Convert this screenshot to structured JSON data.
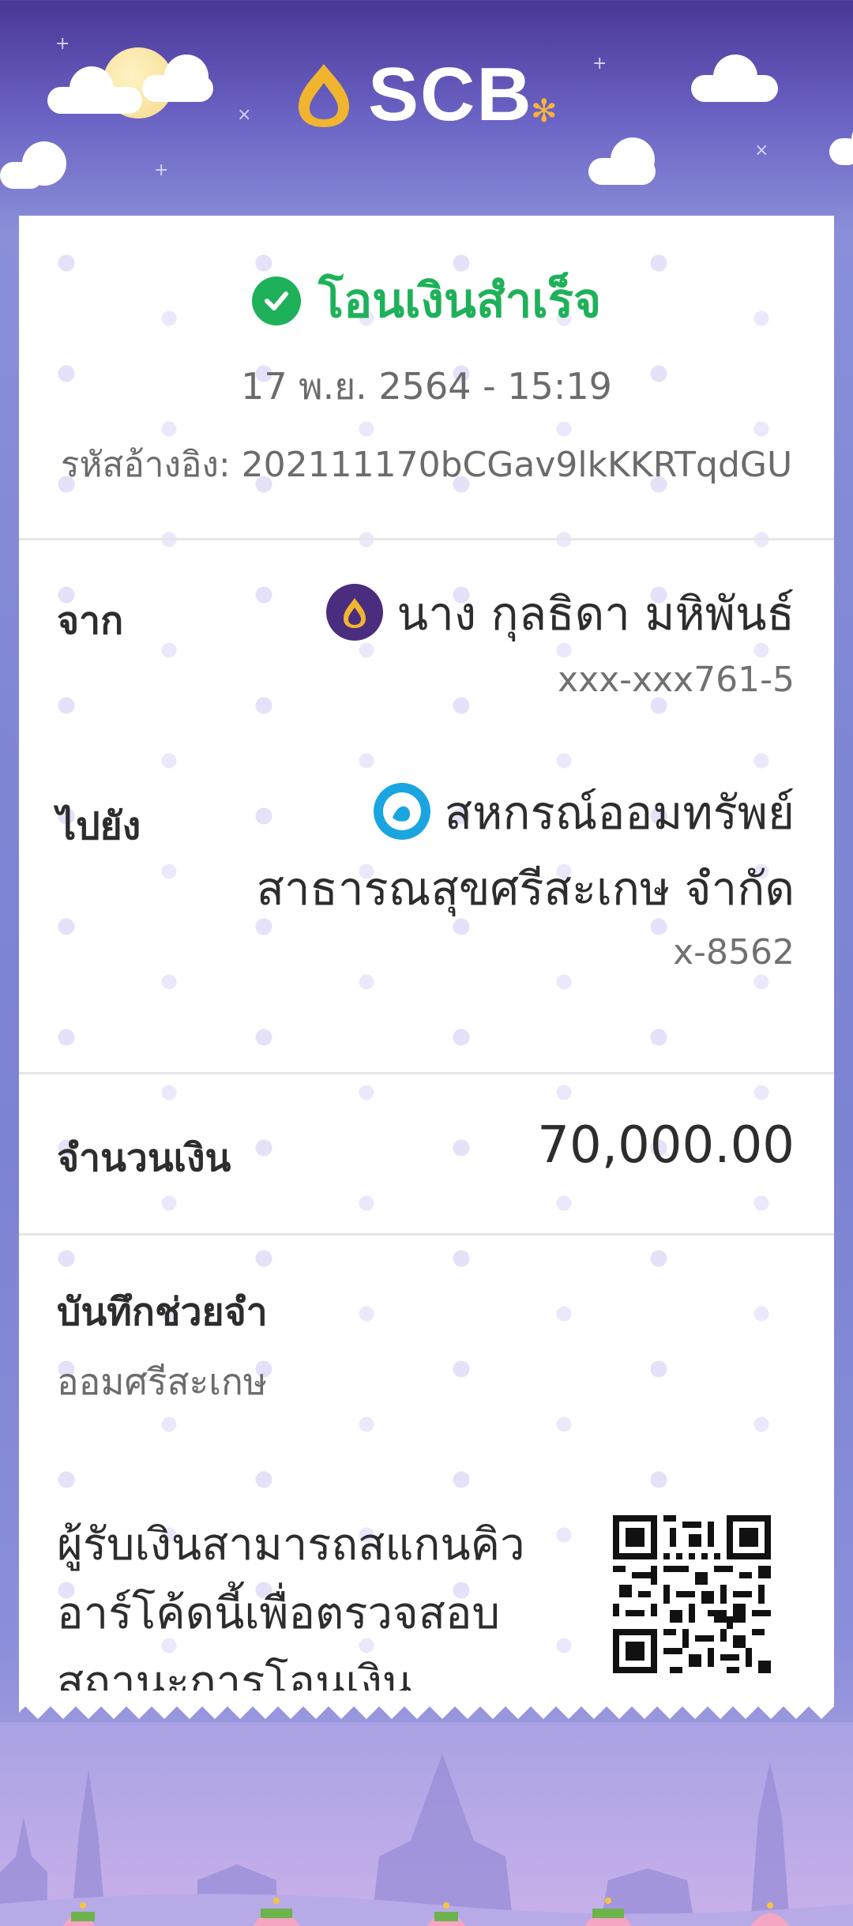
{
  "brand": {
    "name": "SCB"
  },
  "receipt": {
    "status": "โอนเงินสำเร็จ",
    "datetime": "17 พ.ย. 2564 - 15:19",
    "reference": "รหัสอ้างอิง: 202111170bCGav9lkKKRTqdGU"
  },
  "from": {
    "label": "จาก",
    "name": "นาง กุลธิดา มหิพันธ์",
    "account": "xxx-xxx761-5",
    "bank_icon": "scb-bank-icon"
  },
  "to": {
    "label": "ไปยัง",
    "name_line1": "สหกรณ์ออมทรัพย์",
    "name_line2": "สาธารณสุขศรีสะเกษ จำกัด",
    "account": "x-8562",
    "bank_icon": "ktb-bank-icon"
  },
  "amount": {
    "label": "จำนวนเงิน",
    "value": "70,000.00"
  },
  "memo": {
    "label": "บันทึกช่วยจำ",
    "value": "ออมศรีสะเกษ"
  },
  "qr": {
    "text": "ผู้รับเงินสามารถสแกนคิวอาร์โค้ดนี้เพื่อตรวจสอบสถานะการโอนเงิน"
  },
  "colors": {
    "success": "#1fb15a",
    "brand_purple": "#4a2d7e",
    "brand_gold": "#f0b42f"
  }
}
